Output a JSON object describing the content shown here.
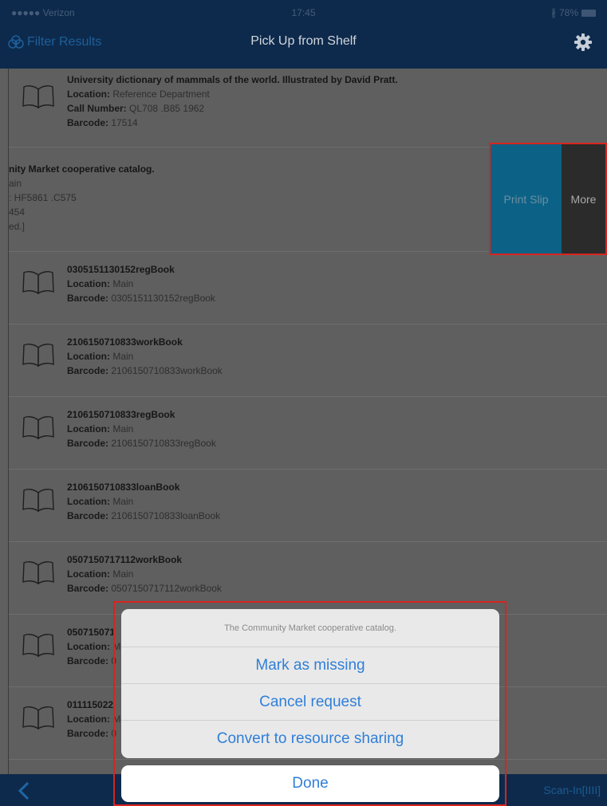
{
  "status_bar": {
    "carrier": "●●●●● Verizon",
    "time": "17:45",
    "battery": "78%"
  },
  "nav": {
    "filter_label": "Filter Results",
    "title": "Pick Up from Shelf",
    "settings_icon": "gear-icon"
  },
  "items": [
    {
      "title": "University dictionary of mammals of the world. Illustrated by David Pratt.",
      "location": "Reference Department",
      "call_number": "QL708 .B85 1962",
      "barcode": "17514"
    },
    {
      "title": "0305151130152regBook",
      "location": "Main",
      "barcode": "0305151130152regBook"
    },
    {
      "title": "2106150710833workBook",
      "location": "Main",
      "barcode": "2106150710833workBook"
    },
    {
      "title": "2106150710833regBook",
      "location": "Main",
      "barcode": "2106150710833regBook"
    },
    {
      "title": "2106150710833loanBook",
      "location": "Main",
      "barcode": "2106150710833loanBook"
    },
    {
      "title": "0507150717112workBook",
      "location": "Main",
      "barcode": "0507150717112workBook"
    },
    {
      "title": "050715071",
      "location": "M",
      "barcode": "0"
    },
    {
      "title": "011115022",
      "location": "M",
      "barcode": "0"
    }
  ],
  "labels": {
    "location": "Location:",
    "call_number": "Call Number:",
    "barcode": "Barcode:"
  },
  "swiped_item": {
    "line1": "nity Market cooperative catalog.",
    "line2": "ain",
    "line3": ": HF5861 .C575",
    "line4": "454",
    "line5": "ed.]"
  },
  "swipe_actions": {
    "print_label": "Print Slip",
    "more_label": "More"
  },
  "action_sheet": {
    "message": "The Community Market cooperative catalog.",
    "buttons": [
      "Mark as missing",
      "Cancel request",
      "Convert to resource sharing"
    ],
    "done_label": "Done"
  },
  "toolbar": {
    "scan_label": "Scan-In[IIII]"
  }
}
